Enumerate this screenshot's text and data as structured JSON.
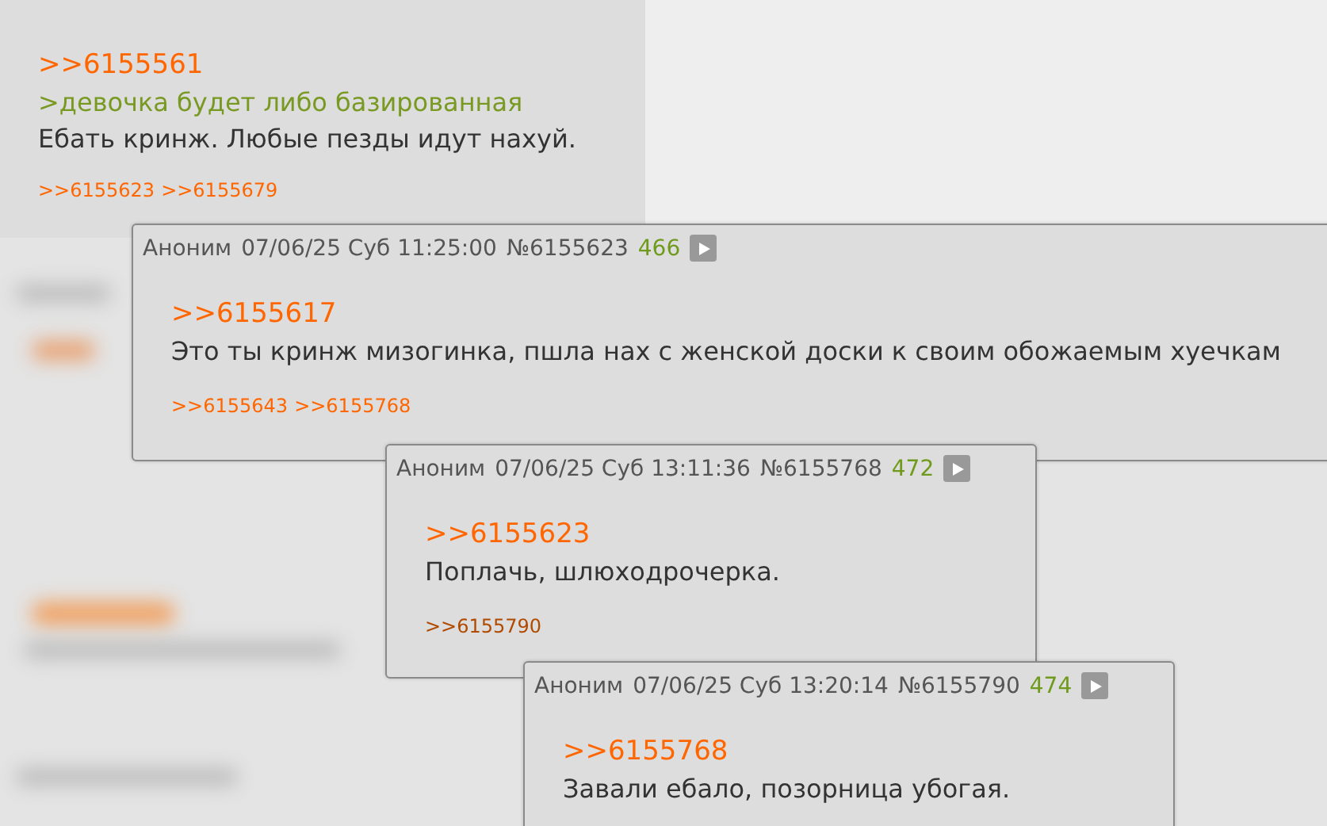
{
  "post": {
    "lines": [
      {
        "kind": "reply",
        "text": ">>6155561"
      },
      {
        "kind": "greentext",
        "text": ">девочка будет либо базированная"
      },
      {
        "kind": "text",
        "text": "Ебать кринж. Любые пезды идут нахуй."
      }
    ],
    "backlinks": [
      {
        "label": ">>6155623",
        "visited": false
      },
      {
        "label": ">>6155679",
        "visited": false
      }
    ]
  },
  "previews": [
    {
      "author": "Аноним",
      "date": "07/06/25 Суб 11:25:00",
      "number": "№6155623",
      "count": "466",
      "lines": [
        {
          "kind": "reply",
          "text": ">>6155617"
        },
        {
          "kind": "text",
          "text": "Это ты кринж мизогинка, пшла нах с женской доски к своим обожаемым хуечкам"
        }
      ],
      "backlinks": [
        {
          "label": ">>6155643",
          "visited": false
        },
        {
          "label": ">>6155768",
          "visited": false
        }
      ]
    },
    {
      "author": "Аноним",
      "date": "07/06/25 Суб 13:11:36",
      "number": "№6155768",
      "count": "472",
      "lines": [
        {
          "kind": "reply",
          "text": ">>6155623"
        },
        {
          "kind": "text",
          "text": "Поплачь, шлюходрочерка."
        }
      ],
      "backlinks": [
        {
          "label": ">>6155790",
          "visited": true
        }
      ]
    },
    {
      "author": "Аноним",
      "date": "07/06/25 Суб 13:20:14",
      "number": "№6155790",
      "count": "474",
      "lines": [
        {
          "kind": "reply",
          "text": ">>6155768"
        },
        {
          "kind": "text",
          "text": "Завали ебало, позорница убогая."
        }
      ]
    }
  ]
}
